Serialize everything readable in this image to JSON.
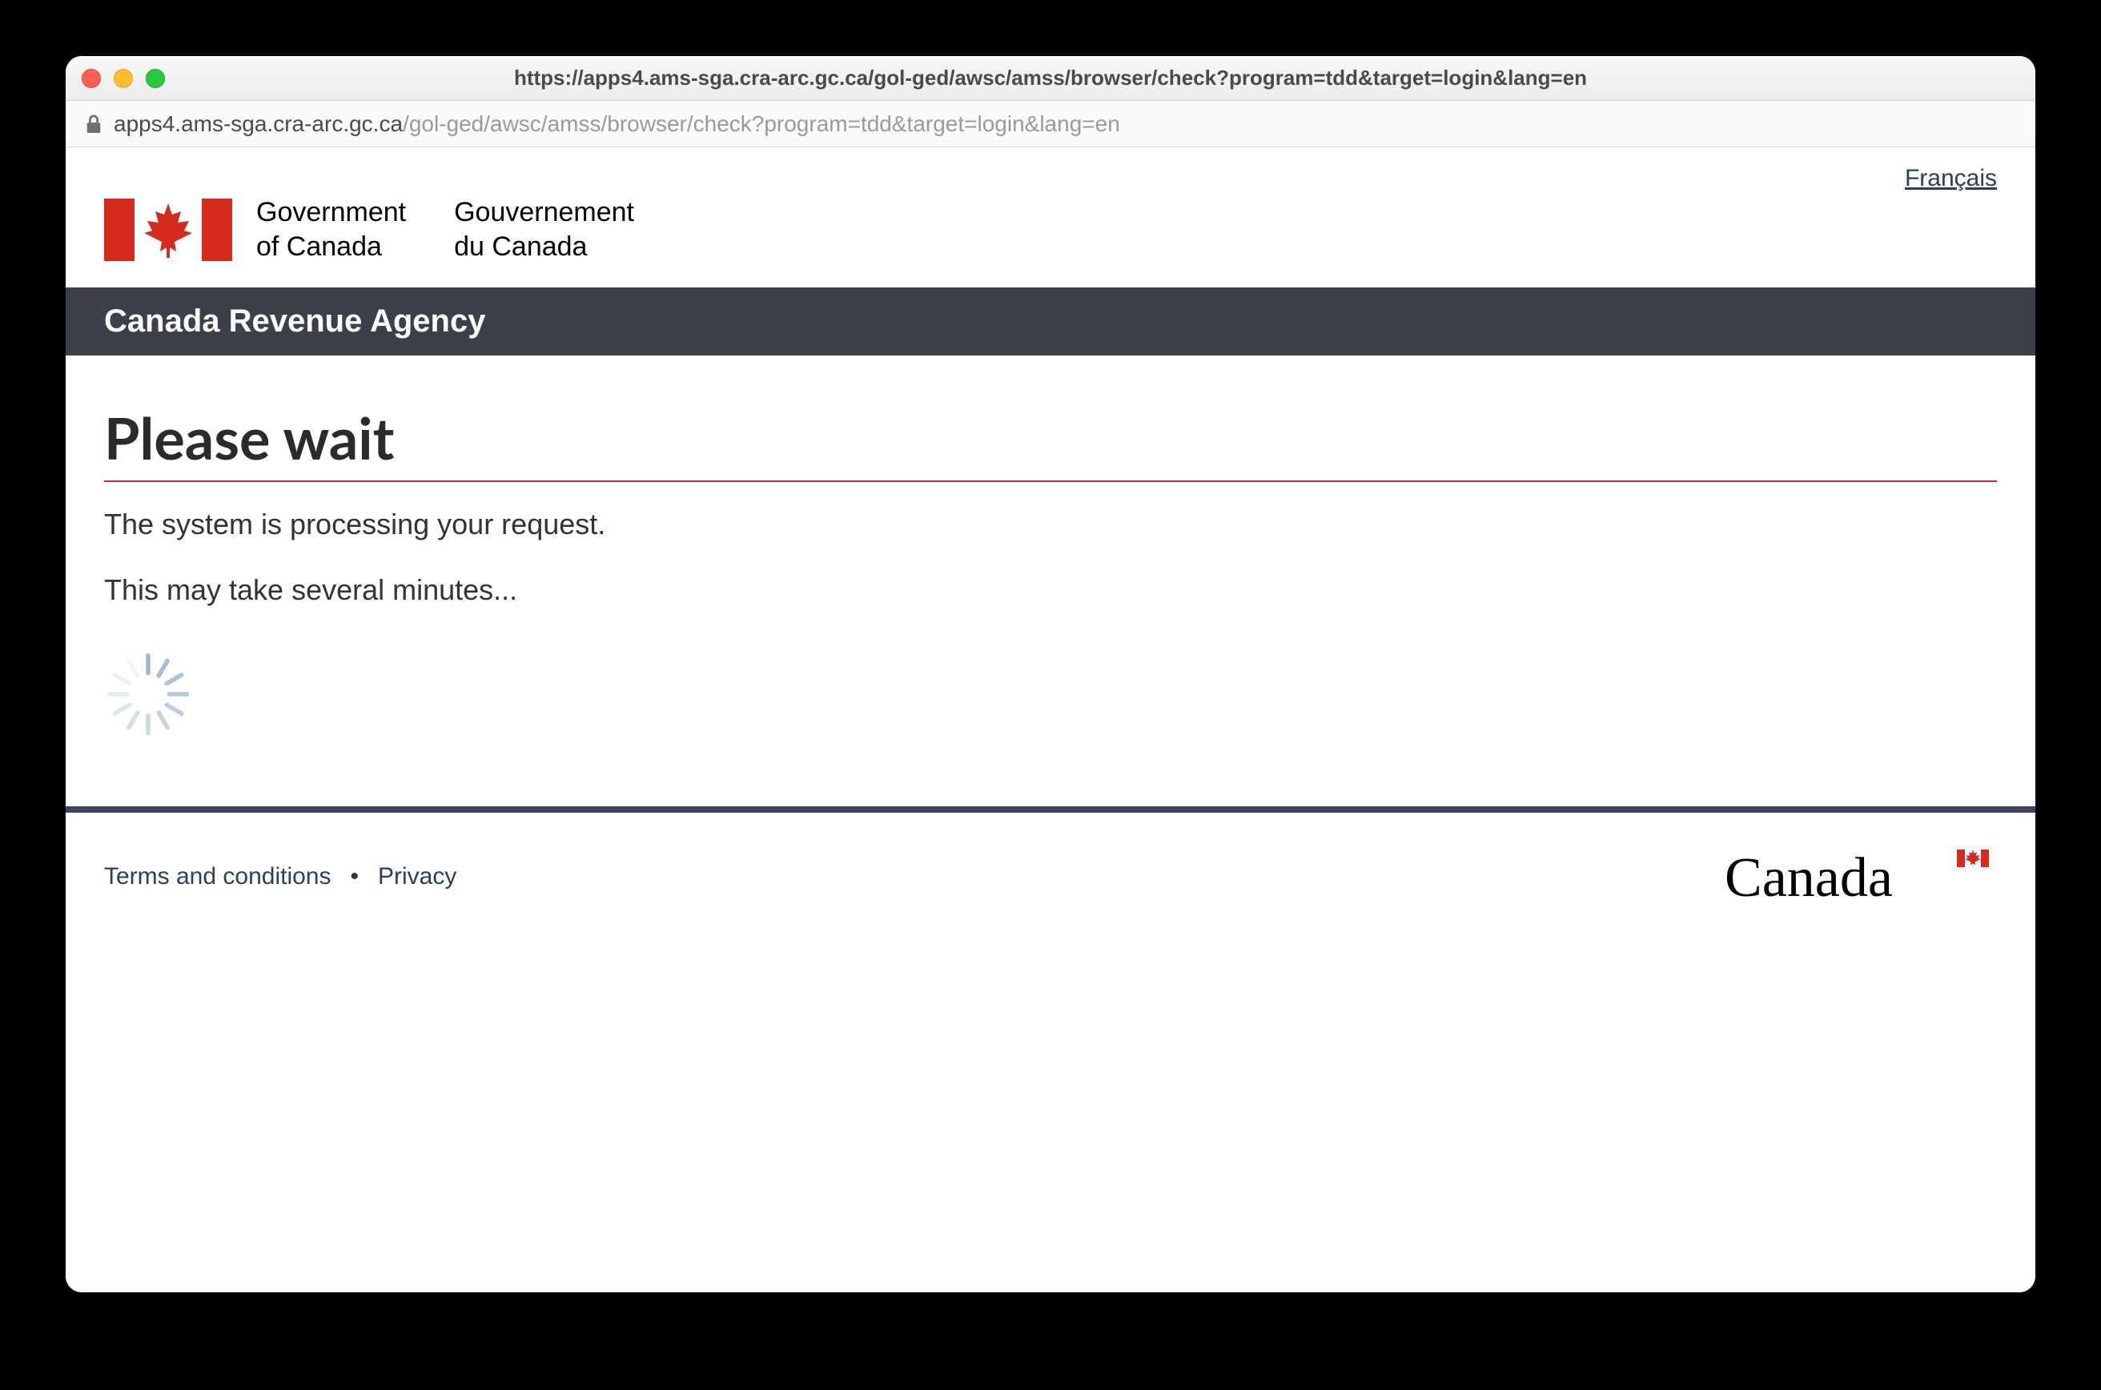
{
  "browser": {
    "title_url": "https://apps4.ams-sga.cra-arc.gc.ca/gol-ged/awsc/amss/browser/check?program=tdd&target=login&lang=en",
    "address_host": "apps4.ams-sga.cra-arc.gc.ca",
    "address_path": "/gol-ged/awsc/amss/browser/check?program=tdd&target=login&lang=en"
  },
  "header": {
    "language_toggle": "Français",
    "goc_en_line1": "Government",
    "goc_en_line2": "of Canada",
    "goc_fr_line1": "Gouvernement",
    "goc_fr_line2": "du Canada",
    "agency_bar": "Canada Revenue Agency"
  },
  "content": {
    "heading": "Please wait",
    "para1": "The system is processing your request.",
    "para2": "This may take several minutes..."
  },
  "footer": {
    "terms": "Terms and conditions",
    "privacy": "Privacy",
    "wordmark_text": "Canada"
  }
}
